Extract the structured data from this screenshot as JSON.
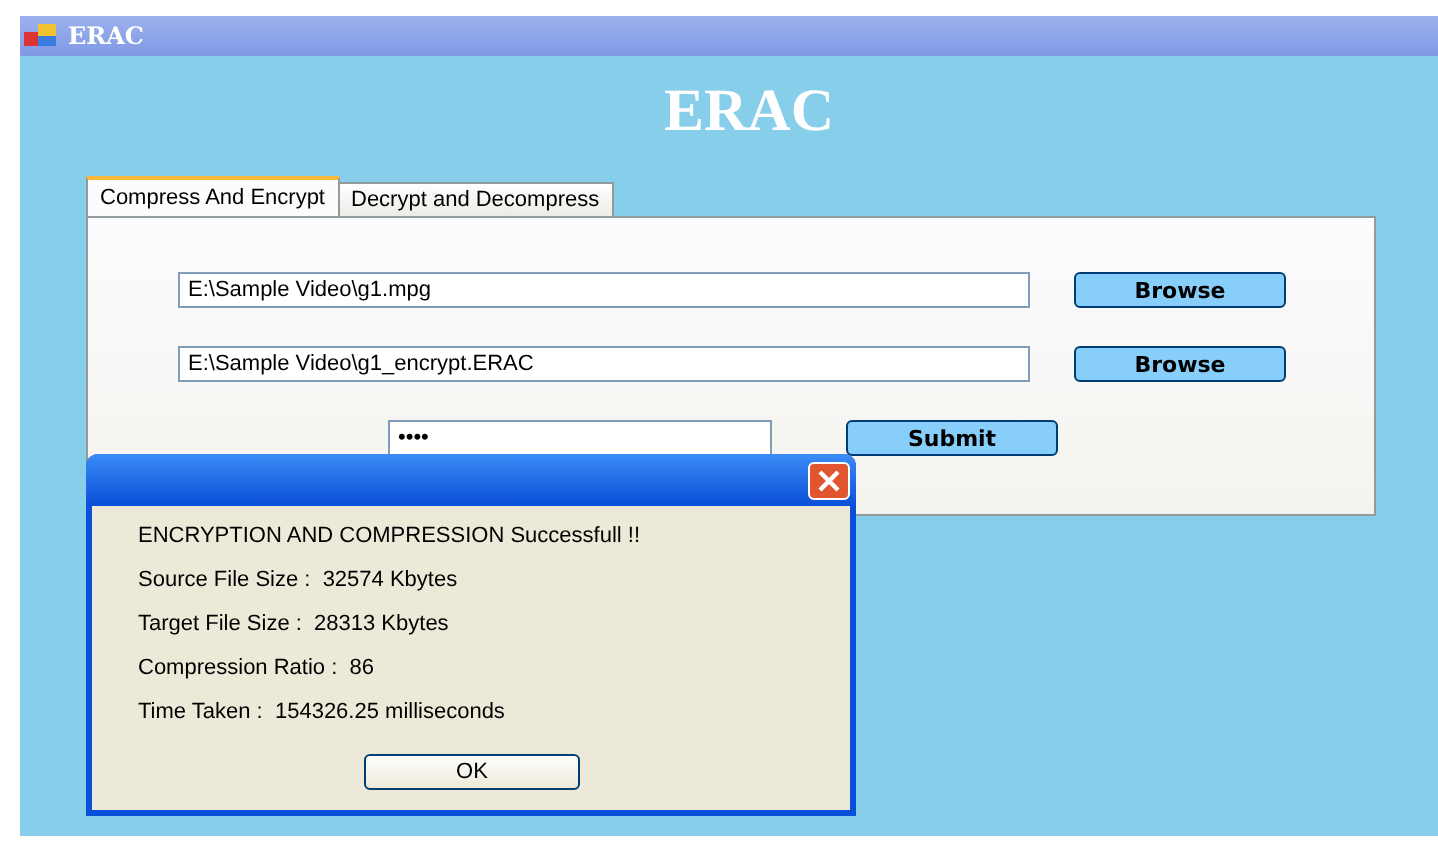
{
  "window": {
    "title": "ERAC"
  },
  "heading": "ERAC",
  "tabs": [
    {
      "label": "Compress And Encrypt",
      "selected": true
    },
    {
      "label": "Decrypt and Decompress",
      "selected": false
    }
  ],
  "files": [
    {
      "value": "E:\\Sample Video\\g1.mpg",
      "button": "Browse"
    },
    {
      "value": "E:\\Sample Video\\g1_encrypt.ERAC",
      "button": "Browse"
    }
  ],
  "password": {
    "value": "••••"
  },
  "submit": "Submit",
  "dialog": {
    "lines": [
      "ENCRYPTION AND COMPRESSION Successfull !!",
      "Source File Size :  32574 Kbytes",
      "Target File Size :  28313 Kbytes",
      "Compression Ratio :  86",
      "Time Taken :  154326.25 milliseconds"
    ],
    "ok": "OK"
  }
}
